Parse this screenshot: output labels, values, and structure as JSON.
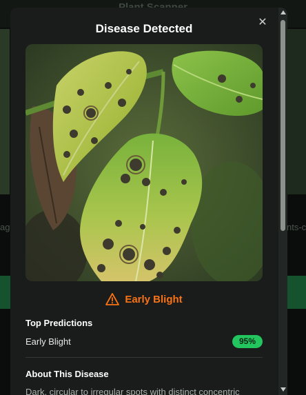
{
  "background": {
    "app_title": "Plant Scanner",
    "left_text_fragment": "ag",
    "right_text_fragment": "nts-c"
  },
  "modal": {
    "title": "Disease Detected",
    "close_icon": "close-icon",
    "result": {
      "icon": "warning-triangle-icon",
      "label": "Early Blight",
      "color": "#f97316"
    },
    "top_predictions": {
      "title": "Top Predictions",
      "items": [
        {
          "name": "Early Blight",
          "confidence": "95%"
        }
      ]
    },
    "about": {
      "title": "About This Disease",
      "text": "Dark, circular to irregular spots with distinct concentric"
    }
  },
  "colors": {
    "badge": "#22c55e",
    "accent_warning": "#f97316",
    "modal_bg": "#191c1a"
  }
}
